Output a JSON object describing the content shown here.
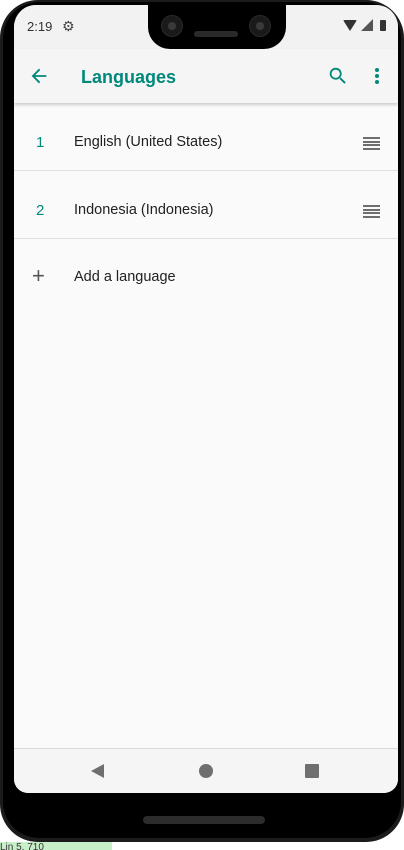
{
  "status_bar": {
    "time": "2:19",
    "settings_icon": "gear-icon",
    "wifi_icon": "wifi-icon",
    "signal_icon": "cell-signal-icon",
    "battery_icon": "battery-icon"
  },
  "app_bar": {
    "title": "Languages",
    "back_icon": "arrow-back-icon",
    "search_icon": "search-icon",
    "more_icon": "more-vert-icon"
  },
  "languages": [
    {
      "index": "1",
      "name": "English (United States)"
    },
    {
      "index": "2",
      "name": "Indonesia (Indonesia)"
    }
  ],
  "add_language": {
    "label": "Add a language",
    "icon": "plus-icon"
  },
  "nav_bar": {
    "back_icon": "nav-back-icon",
    "home_icon": "nav-home-icon",
    "recents_icon": "nav-recents-icon"
  },
  "footer_label": "Lin 5, 710",
  "colors": {
    "accent": "#00897b",
    "background": "#fafafa",
    "text": "#212121"
  }
}
